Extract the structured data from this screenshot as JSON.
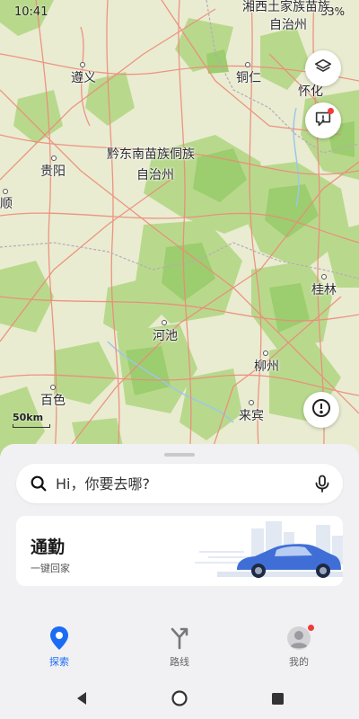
{
  "status": {
    "time": "10:41",
    "battery": "33%"
  },
  "map": {
    "labels": {
      "xiangxi": "湘西土家族苗族",
      "xiangxi2": "自治州",
      "zunyi": "遵义",
      "tongren": "铜仁",
      "huaihua": "怀化",
      "qiandongnan": "黔东南苗族侗族",
      "qiandongnan2": "自治州",
      "guiyang": "贵阳",
      "shun": "顺",
      "guilin": "桂林",
      "hechi": "河池",
      "liuzhou": "柳州",
      "baise": "百色",
      "laibin": "来宾"
    },
    "scale": "50km",
    "colors": {
      "base": "#e9ecd1",
      "forest": "#b8d98c",
      "forest_dark": "#9ccd6e",
      "road": "#ee8a7a",
      "river": "#9cc7e8"
    }
  },
  "controls": {
    "layers": "layers-icon",
    "feedback": "feedback-icon",
    "report": "alert-icon"
  },
  "search": {
    "placeholder": "Hi，你要去哪?"
  },
  "commute": {
    "title": "通勤",
    "subtitle": "一键回家"
  },
  "tabs": [
    {
      "label": "探索",
      "icon": "location-pin-icon",
      "active": true
    },
    {
      "label": "路线",
      "icon": "route-icon",
      "active": false
    },
    {
      "label": "我的",
      "icon": "avatar-icon",
      "active": false
    }
  ],
  "accent_color": "#1a6cf5"
}
